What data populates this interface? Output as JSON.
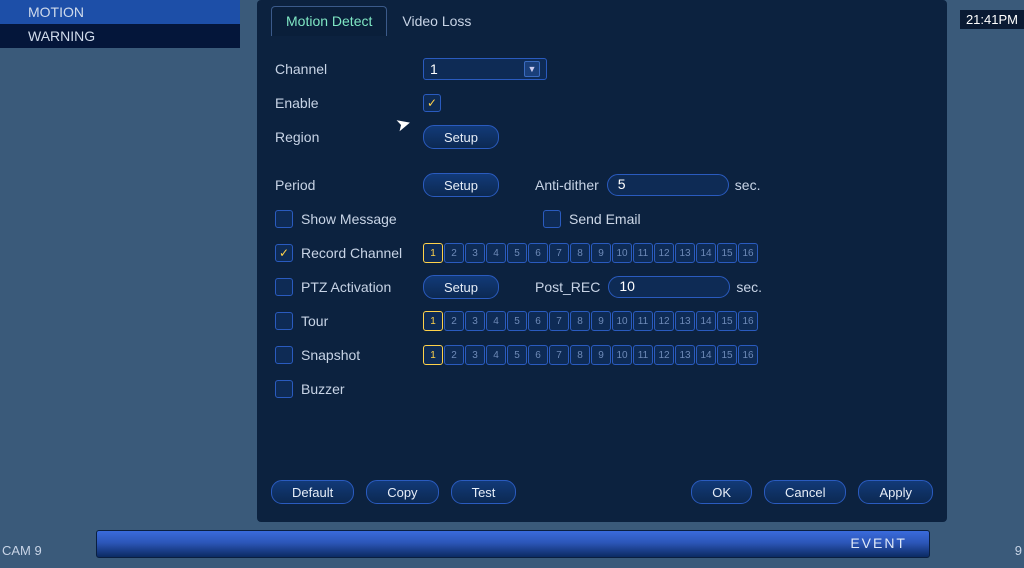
{
  "time": "21:41PM",
  "sidebar": {
    "items": [
      {
        "label": "MOTION",
        "active": true
      },
      {
        "label": "WARNING",
        "active": false
      }
    ]
  },
  "tabs": [
    {
      "label": "Motion Detect",
      "active": true
    },
    {
      "label": "Video Loss",
      "active": false
    }
  ],
  "form": {
    "channel_label": "Channel",
    "channel_value": "1",
    "enable_label": "Enable",
    "enable_checked": true,
    "region_label": "Region",
    "region_btn": "Setup",
    "period_label": "Period",
    "period_btn": "Setup",
    "antidither_label": "Anti-dither",
    "antidither_value": "5",
    "antidither_unit": "sec.",
    "show_message_label": "Show Message",
    "show_message_checked": false,
    "send_email_label": "Send Email",
    "send_email_checked": false,
    "record_channel_label": "Record Channel",
    "record_channel_checked": true,
    "record_channel_strip": {
      "count": 16,
      "selected": [
        1
      ]
    },
    "ptz_label": "PTZ Activation",
    "ptz_checked": false,
    "ptz_btn": "Setup",
    "postrec_label": "Post_REC",
    "postrec_value": "10",
    "postrec_unit": "sec.",
    "tour_label": "Tour",
    "tour_checked": false,
    "tour_strip": {
      "count": 16,
      "selected": [
        1
      ]
    },
    "snapshot_label": "Snapshot",
    "snapshot_checked": false,
    "snapshot_strip": {
      "count": 16,
      "selected": [
        1
      ]
    },
    "buzzer_label": "Buzzer",
    "buzzer_checked": false
  },
  "buttons": {
    "default": "Default",
    "copy": "Copy",
    "test": "Test",
    "ok": "OK",
    "cancel": "Cancel",
    "apply": "Apply"
  },
  "status": {
    "cam": "CAM 9",
    "event": "EVENT",
    "right_num": "9"
  }
}
